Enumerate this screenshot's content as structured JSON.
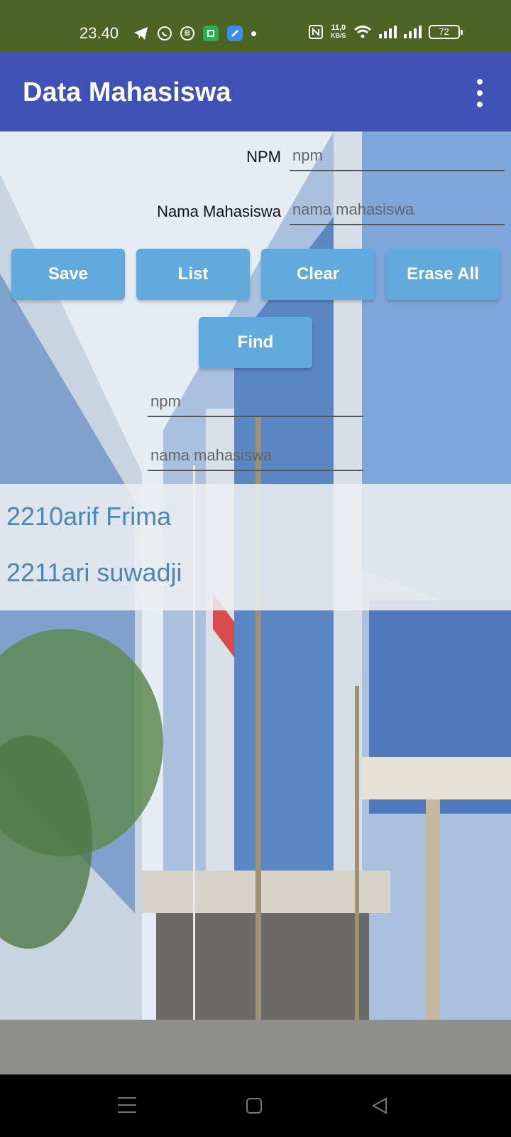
{
  "status_bar": {
    "time": "23.40",
    "speed_value": "11,0",
    "speed_unit": "KB/S",
    "battery": "72",
    "b_icon": "B",
    "icons": [
      "telegram-icon",
      "whatsapp-icon",
      "b-icon",
      "app-green-icon",
      "app-blue-icon",
      "nfc-icon",
      "wifi-icon",
      "signal-icon",
      "signal-icon",
      "battery-icon"
    ]
  },
  "app_bar": {
    "title": "Data Mahasiswa",
    "menu_icon": "overflow-menu-icon"
  },
  "form": {
    "npm_label": "NPM",
    "npm_placeholder": "npm",
    "nama_label": "Nama Mahasiswa",
    "nama_placeholder": "nama mahasiswa"
  },
  "buttons": {
    "save": "Save",
    "list": "List",
    "clear": "Clear",
    "erase_all": "Erase All",
    "find": "Find"
  },
  "find_form": {
    "npm_placeholder": "npm",
    "nama_placeholder": "nama mahasiswa"
  },
  "list": {
    "items": [
      "2210arif Frima",
      "2211ari suwadji"
    ]
  },
  "colors": {
    "status_bar": "#4c6424",
    "app_bar": "#3f51b5",
    "button": "#62aadb",
    "list_text": "#4a87b4"
  }
}
